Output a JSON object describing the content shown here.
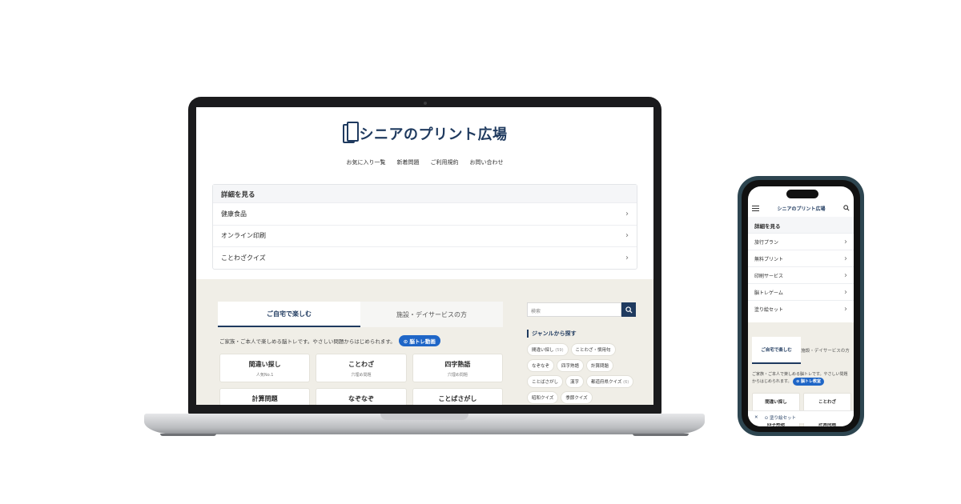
{
  "site": {
    "logo_text": "シニアのプリント広場",
    "nav": [
      "お気に入り一覧",
      "新着問題",
      "ご利用規約",
      "お問い合わせ"
    ]
  },
  "details": {
    "title": "詳細を見る",
    "items": [
      "健康食品",
      "オンライン印刷",
      "ことわざクイズ"
    ]
  },
  "tabs": {
    "active": "ご自宅で楽しむ",
    "inactive": "施設・デイサービスの方"
  },
  "description": "ご家族・ご本人で楽しめる脳トレです。やさしい問題からはじめられます。",
  "video_pill": "脳トレ動画",
  "cards": [
    {
      "title": "間違い探し",
      "sub": "人気No.1"
    },
    {
      "title": "ことわざ",
      "sub": "穴埋め問題"
    },
    {
      "title": "四字熟語",
      "sub": "穴埋め問題"
    },
    {
      "title": "計算問題",
      "sub": ""
    },
    {
      "title": "なぞなぞ",
      "sub": ""
    },
    {
      "title": "ことばさがし",
      "sub": ""
    }
  ],
  "search": {
    "placeholder": "検索"
  },
  "genre": {
    "title": "ジャンルから探す",
    "tags": [
      {
        "label": "間違い探し",
        "count": "(59)"
      },
      {
        "label": "ことわざ・慣用句",
        "count": ""
      },
      {
        "label": "なぞなぞ",
        "count": ""
      },
      {
        "label": "四字熟語",
        "count": ""
      },
      {
        "label": "計算問題",
        "count": ""
      },
      {
        "label": "ことばさがし",
        "count": ""
      },
      {
        "label": "漢字",
        "count": ""
      },
      {
        "label": "都道府県クイズ",
        "count": "(6)"
      },
      {
        "label": "昭和クイズ",
        "count": ""
      },
      {
        "label": "季節クイズ",
        "count": ""
      }
    ]
  },
  "phone": {
    "logo_text": "シニアのプリント広場",
    "details_title": "詳細を見る",
    "items": [
      "旅行プラン",
      "無料プリント",
      "印刷サービス",
      "脳トレゲーム",
      "塗り絵セット"
    ],
    "tab_active": "ご自宅で楽しむ",
    "tab_inactive": "施設・デイサービスの方",
    "description": "ご家族・ご本人で楽しめる脳トレです。やさしい問題からはじめられます。",
    "pill": "脳トレ教室",
    "cards": [
      "間違い探し",
      "ことわざ",
      "四字熟語",
      "計算問題"
    ],
    "bottom_label": "塗り絵セット"
  },
  "colors": {
    "brand": "#1f3a5f",
    "pill": "#1f66c7",
    "beige": "#f0eee7"
  }
}
